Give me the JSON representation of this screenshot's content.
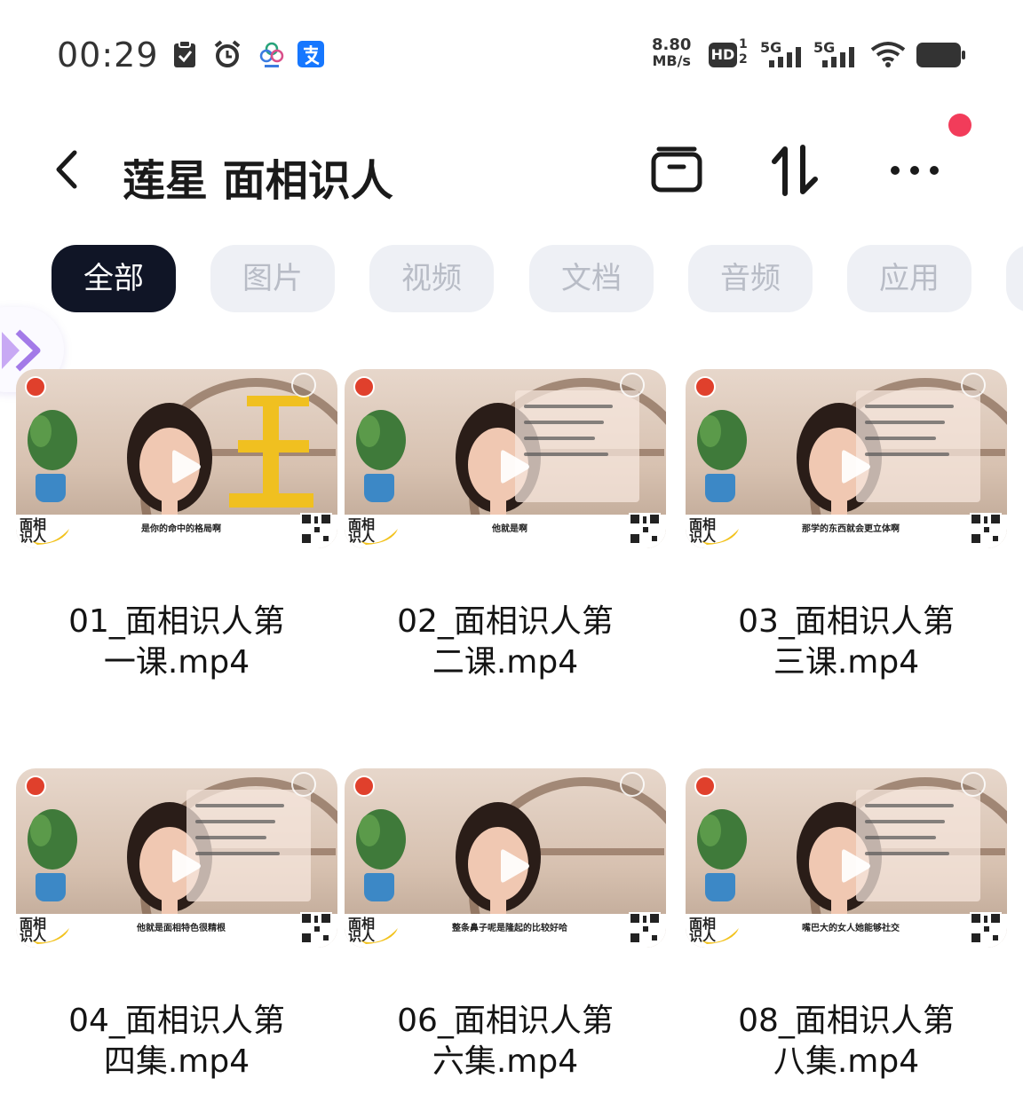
{
  "status_bar": {
    "time": "00:29",
    "net_speed_value": "8.80",
    "net_speed_unit": "MB/s",
    "hd_label": "HD",
    "hd_sub_top": "1",
    "hd_sub_bottom": "2",
    "sim1_label": "5G",
    "sim2_label": "5G",
    "icons": [
      "clipboard-check-icon",
      "alarm-icon",
      "clover-app-icon",
      "alipay-icon",
      "wifi-icon",
      "battery-icon"
    ]
  },
  "header": {
    "title": "莲星 面相识人",
    "actions": [
      "archive-icon",
      "sort-icon",
      "more-icon"
    ]
  },
  "tabs": [
    {
      "label": "全部",
      "active": true
    },
    {
      "label": "图片",
      "active": false
    },
    {
      "label": "视频",
      "active": false
    },
    {
      "label": "文档",
      "active": false
    },
    {
      "label": "音频",
      "active": false
    },
    {
      "label": "应用",
      "active": false
    }
  ],
  "files": [
    {
      "name_line1": "01_面相识人第",
      "name_line2": "一课.mp4",
      "caption": "是你的命中的格局啊",
      "overlay": "gold"
    },
    {
      "name_line1": "02_面相识人第",
      "name_line2": "二课.mp4",
      "caption": "他就是啊",
      "overlay": "panel"
    },
    {
      "name_line1": "03_面相识人第",
      "name_line2": "三课.mp4",
      "caption": "那学的东西就会更立体啊",
      "overlay": "panel"
    },
    {
      "name_line1": "04_面相识人第",
      "name_line2": "四集.mp4",
      "caption": "他就是面相特色很精根",
      "overlay": "panel"
    },
    {
      "name_line1": "06_面相识人第",
      "name_line2": "六集.mp4",
      "caption": "整条鼻子呢是隆起的比较好哈",
      "overlay": "none"
    },
    {
      "name_line1": "08_面相识人第",
      "name_line2": "八集.mp4",
      "caption": "嘴巴大的女人她能够社交",
      "overlay": "panel"
    }
  ],
  "thumb_badge": "面相识人",
  "colors": {
    "active_tab_bg": "#101526",
    "inactive_tab_bg": "#eef0f5",
    "inactive_tab_text": "#b8bcc6",
    "notification_dot": "#f23c5a"
  }
}
